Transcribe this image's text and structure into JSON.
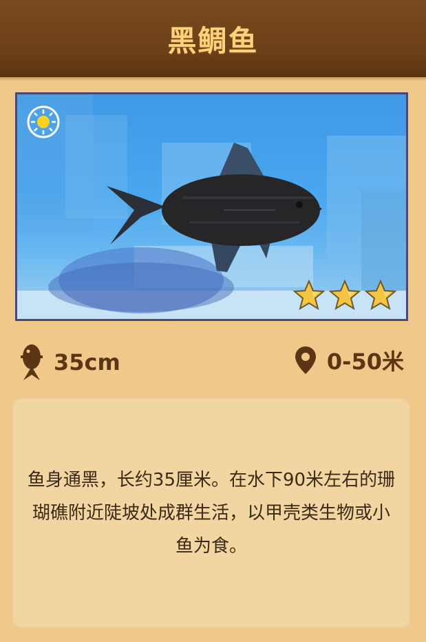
{
  "header": {
    "title": "黑鲷鱼"
  },
  "scene": {
    "weather_icon": "sun-icon",
    "rating_stars": 3,
    "star_icon": "star-icon"
  },
  "stats": {
    "size": {
      "icon": "fish-icon",
      "value": "35cm"
    },
    "depth": {
      "icon": "location-pin-icon",
      "value": "0-50米"
    }
  },
  "description": {
    "text": "鱼身通黑，长约35厘米。在水下90米左右的珊瑚礁附近陡坡处成群生活，以甲壳类生物或小鱼为食。"
  },
  "colors": {
    "header_bg": "#6b3f17",
    "title": "#ffd27a",
    "page_bg": "#f0c98a",
    "card_bg": "#f2d6a1",
    "stat_text": "#5b3615"
  }
}
